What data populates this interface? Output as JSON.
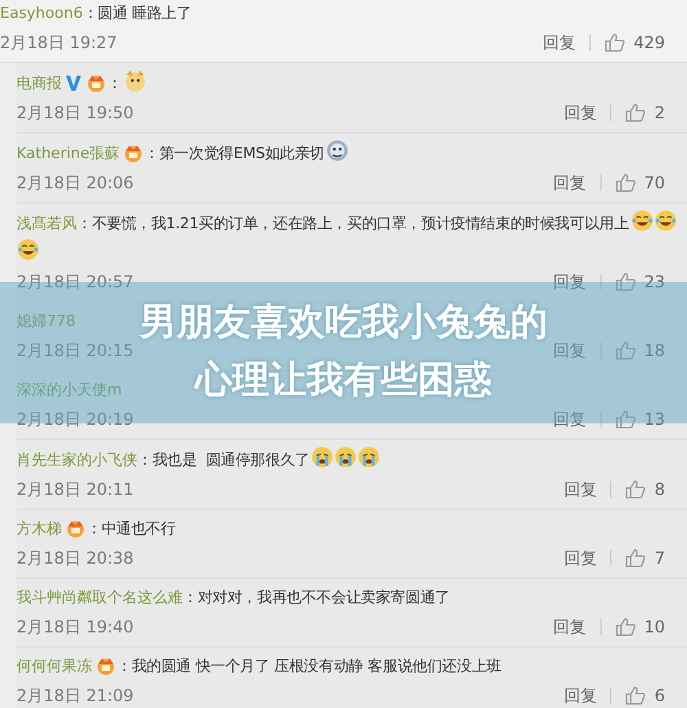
{
  "comments": [
    {
      "user": "Easyhoon6",
      "nested": false,
      "text": "：圆通 睡路上了",
      "time": "2月18日 19:27",
      "reply": "回复",
      "likes": "429"
    },
    {
      "user": "电商报",
      "nested": true,
      "badges": [
        {
          "kind": "verified"
        },
        {
          "kind": "vip"
        }
      ],
      "text": "：",
      "emojis": [
        {
          "kind": "dog"
        }
      ],
      "time": "2月18日 19:50",
      "reply": "回复",
      "likes": "2"
    },
    {
      "user": "Katherine張蘇",
      "nested": true,
      "badges": [
        {
          "kind": "vip"
        }
      ],
      "text": "：第一次觉得EMS如此亲切",
      "emojis": [
        {
          "kind": "sweat"
        }
      ],
      "time": "2月18日 20:06",
      "reply": "回复",
      "likes": "70"
    },
    {
      "user": "浅髙若风",
      "nested": true,
      "text": "：不要慌，我1.21买的订单，还在路上，买的口罩，预计疫情结束的时候我可以用上",
      "emojis": [
        {
          "kind": "laugh"
        },
        {
          "kind": "laugh"
        },
        {
          "kind": "laugh"
        }
      ],
      "time": "2月18日 20:57",
      "reply": "回复",
      "likes": "23"
    },
    {
      "user": "媳婦778",
      "nested": true,
      "time": "2月18日 20:15",
      "reply": "回复",
      "likes": "18"
    },
    {
      "user": "深深的小天使m",
      "nested": true,
      "time": "2月18日 20:19",
      "reply": "回复",
      "likes": "13"
    },
    {
      "user": "肖先生家的小飞侠",
      "nested": true,
      "text": "：我也是  圆通停那很久了",
      "emojis": [
        {
          "kind": "cry"
        },
        {
          "kind": "cry"
        },
        {
          "kind": "cry"
        }
      ],
      "time": "2月18日 20:11",
      "reply": "回复",
      "likes": "8"
    },
    {
      "user": "方木梯",
      "nested": true,
      "badges": [
        {
          "kind": "vip"
        }
      ],
      "text": "：中通也不行",
      "time": "2月18日 20:38",
      "reply": "回复",
      "likes": "7"
    },
    {
      "user": "我斗艸尚粼取个名这么难",
      "nested": true,
      "text": "：对对对，我再也不不会让卖家寄圆通了",
      "time": "2月18日 19:40",
      "reply": "回复",
      "likes": "10"
    },
    {
      "user": "何何何果冻",
      "nested": true,
      "badges": [
        {
          "kind": "vip"
        }
      ],
      "text": "：我的圆通 快一个月了 压根没有动静 客服说他们还没上班",
      "time": "2月18日 21:09",
      "reply": "回复",
      "likes": "6"
    }
  ],
  "overlay_title": "男朋友喜欢吃我小兔兔的心理让我有些困惑"
}
